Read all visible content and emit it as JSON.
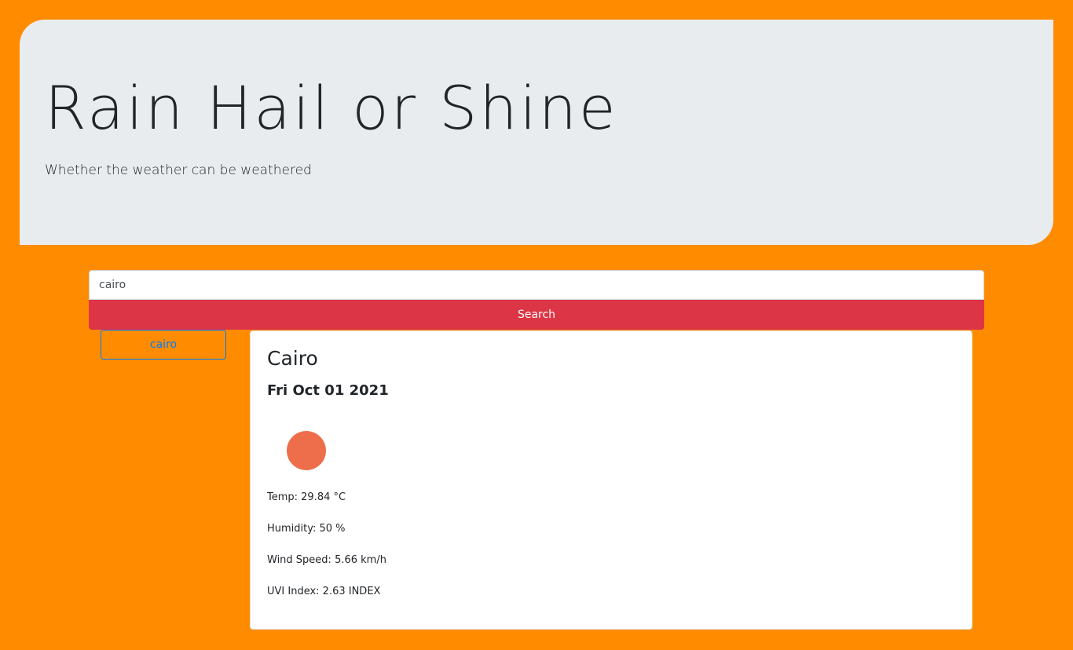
{
  "header": {
    "title": "Rain Hail or Shine",
    "subtitle": "Whether the weather can be weathered"
  },
  "search": {
    "value": "cairo",
    "button_label": "Search"
  },
  "history": {
    "items": [
      {
        "label": "cairo"
      }
    ]
  },
  "weather": {
    "city": "Cairo",
    "date": "Fri Oct 01 2021",
    "icon": "sun-icon",
    "temp": "Temp: 29.84 °C",
    "humidity": "Humidity: 50 %",
    "wind": "Wind Speed: 5.66 km/h",
    "uvi": "UVI Index: 2.63 INDEX"
  },
  "colors": {
    "background": "#ff8c00",
    "jumbotron": "#e9ecef",
    "search_button": "#dc3545",
    "history_outline": "#007bff",
    "sun_icon": "#ee6e4c"
  }
}
